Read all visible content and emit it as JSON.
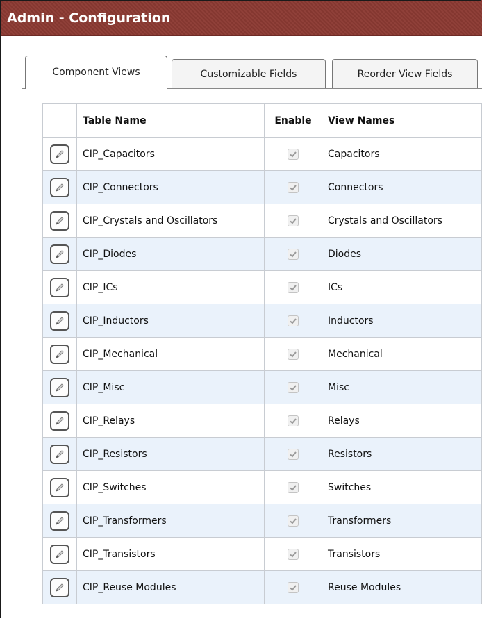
{
  "window": {
    "title": "Admin - Configuration"
  },
  "tabs": [
    {
      "label": "Component Views",
      "active": true
    },
    {
      "label": "Customizable Fields",
      "active": false
    },
    {
      "label": "Reorder View Fields",
      "active": false
    }
  ],
  "table": {
    "columns": [
      "",
      "Table Name",
      "Enable",
      "View Names"
    ],
    "rows": [
      {
        "table_name": "CIP_Capacitors",
        "enabled": true,
        "view_name": "Capacitors"
      },
      {
        "table_name": "CIP_Connectors",
        "enabled": true,
        "view_name": "Connectors"
      },
      {
        "table_name": "CIP_Crystals and Oscillators",
        "enabled": true,
        "view_name": "Crystals and Oscillators"
      },
      {
        "table_name": "CIP_Diodes",
        "enabled": true,
        "view_name": "Diodes"
      },
      {
        "table_name": "CIP_ICs",
        "enabled": true,
        "view_name": "ICs"
      },
      {
        "table_name": "CIP_Inductors",
        "enabled": true,
        "view_name": "Inductors"
      },
      {
        "table_name": "CIP_Mechanical",
        "enabled": true,
        "view_name": "Mechanical"
      },
      {
        "table_name": "CIP_Misc",
        "enabled": true,
        "view_name": "Misc"
      },
      {
        "table_name": "CIP_Relays",
        "enabled": true,
        "view_name": "Relays"
      },
      {
        "table_name": "CIP_Resistors",
        "enabled": true,
        "view_name": "Resistors"
      },
      {
        "table_name": "CIP_Switches",
        "enabled": true,
        "view_name": "Switches"
      },
      {
        "table_name": "CIP_Transformers",
        "enabled": true,
        "view_name": "Transformers"
      },
      {
        "table_name": "CIP_Transistors",
        "enabled": true,
        "view_name": "Transistors"
      },
      {
        "table_name": "CIP_Reuse Modules",
        "enabled": true,
        "view_name": "Reuse Modules"
      }
    ]
  },
  "icons": {
    "edit": "pencil-icon",
    "enable": "checkbox-checked-icon"
  },
  "colors": {
    "titlebar": "#8c3a33",
    "row_alt": "#eaf2fb",
    "border": "#c8ccd2"
  }
}
